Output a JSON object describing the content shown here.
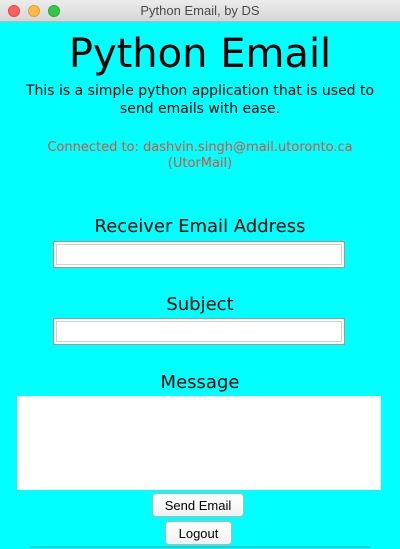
{
  "window": {
    "title": "Python Email, by DS"
  },
  "app": {
    "title": "Python Email",
    "description": "This is a simple python application that is used to send emails with ease.",
    "connected_line1": "Connected to: dashvin.singh@mail.utoronto.ca",
    "connected_line2": "(UtorMail)"
  },
  "form": {
    "receiver_label": "Receiver Email Address",
    "receiver_value": "",
    "subject_label": "Subject",
    "subject_value": "",
    "message_label": "Message",
    "message_value": ""
  },
  "buttons": {
    "send": "Send Email",
    "logout": "Logout"
  },
  "colors": {
    "background": "#00ffff",
    "status_text": "#e34b3a"
  }
}
